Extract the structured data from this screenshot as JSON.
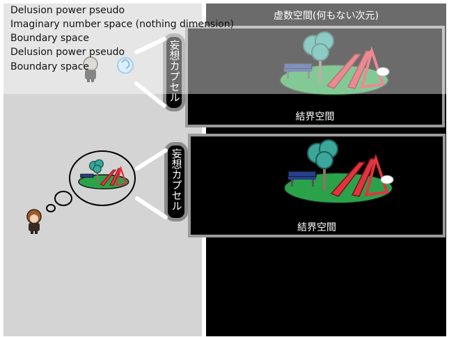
{
  "captions": [
    "Delusion power pseudo",
    "Imaginary number space (nothing dimension)",
    "Boundary space",
    "Delusion power pseudo",
    "Boundary space"
  ],
  "void_title": "虚数空間(何もない次元)",
  "capsule_label": "妄想カプセル",
  "boundary_label": "結界空間",
  "colors": {
    "left_bg": "#d4d4d4",
    "void_bg": "#000000",
    "frame_border": "#9a9a9a",
    "grass": "#2aa24a",
    "slide": "#e03440",
    "bench": "#27408b",
    "tree": "#3aa79a"
  }
}
